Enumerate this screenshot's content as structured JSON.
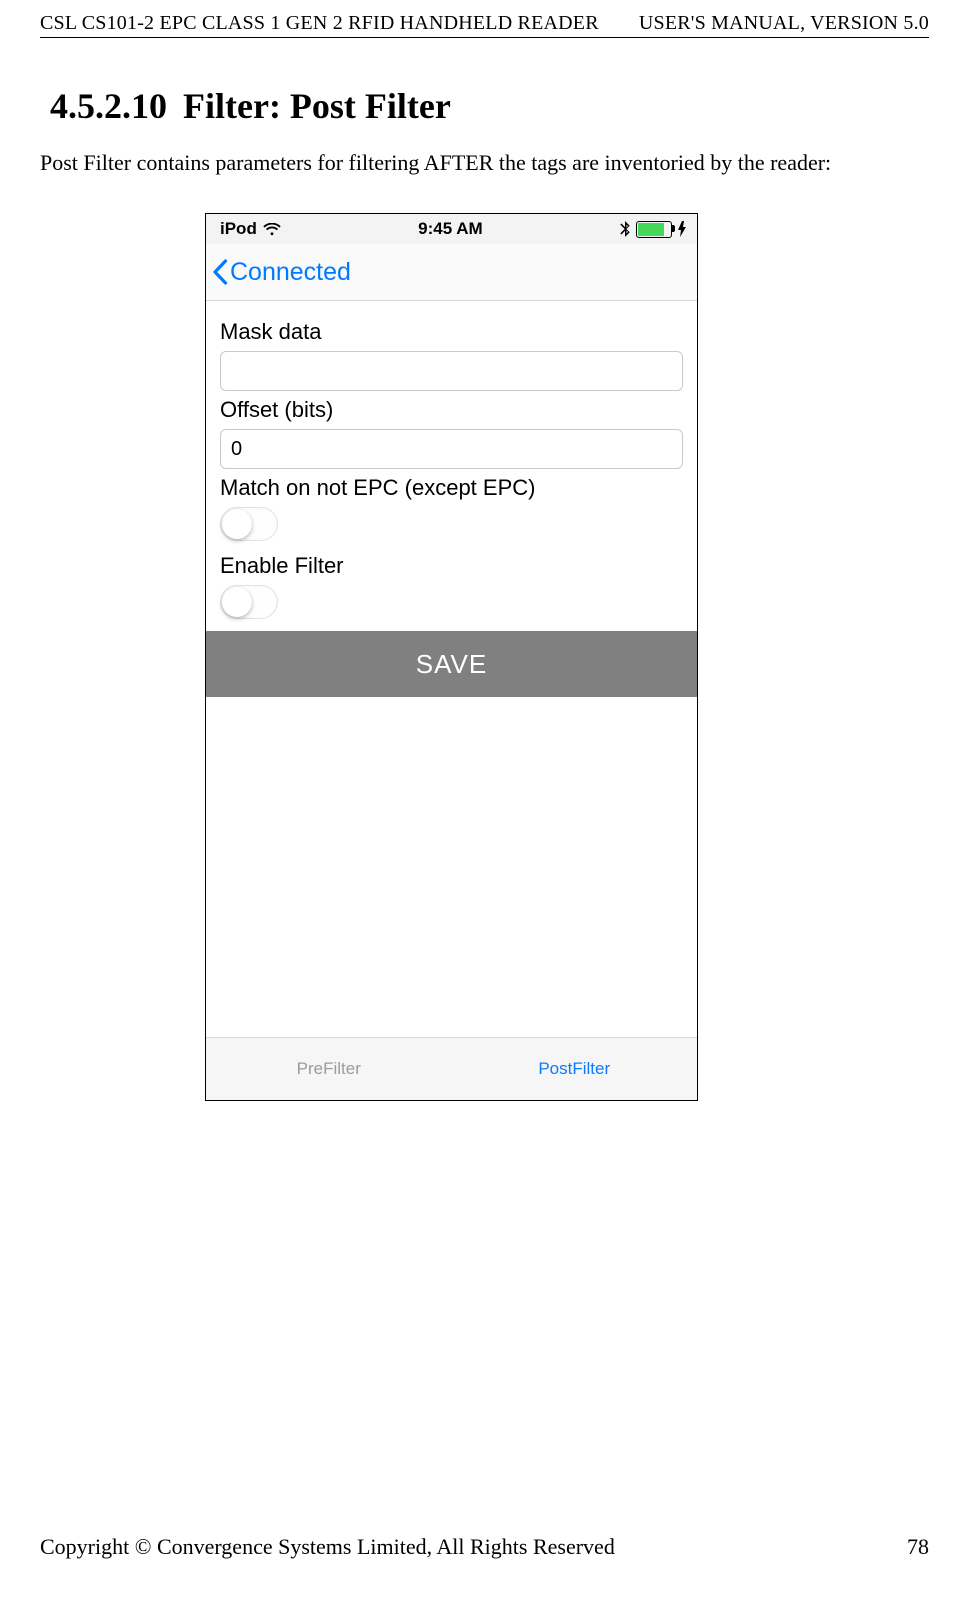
{
  "header": {
    "left": "CSL CS101-2 EPC CLASS 1 GEN 2 RFID HANDHELD READER",
    "right": "USER'S  MANUAL,  VERSION  5.0"
  },
  "section": {
    "number": "4.5.2.10",
    "title": "Filter: Post Filter"
  },
  "intro": "Post Filter contains parameters for filtering AFTER the tags are inventoried by the reader:",
  "screenshot": {
    "status_bar": {
      "device": "iPod",
      "time": "9:45 AM"
    },
    "nav_back_label": "Connected",
    "form": {
      "mask_label": "Mask data",
      "mask_value": "",
      "offset_label": "Offset (bits)",
      "offset_value": "0",
      "match_label": "Match on not EPC (except EPC)",
      "enable_label": "Enable Filter",
      "save_label": "SAVE"
    },
    "tabs": {
      "prefilter": "PreFilter",
      "postfilter": "PostFilter"
    }
  },
  "footer": {
    "copyright": "Copyright © Convergence Systems Limited, All Rights Reserved",
    "page_number": "78"
  }
}
